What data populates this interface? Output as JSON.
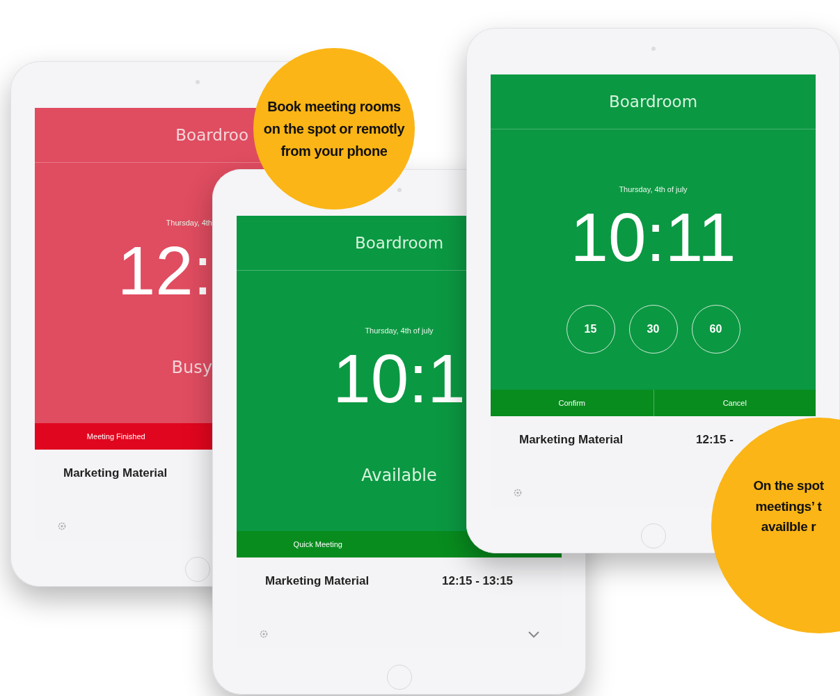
{
  "tablets": [
    {
      "busy": true,
      "room": "Boardroo",
      "date": "Thursday, 4th",
      "time": "12:",
      "state_label": "Busy",
      "actions": [
        "Meeting Finished"
      ],
      "meeting": {
        "title": "Marketing Material"
      }
    },
    {
      "busy": false,
      "room": "Boardroom",
      "date": "Thursday, 4th of july",
      "time": "10:1",
      "state_label": "Available",
      "actions": [
        "Quick Meeting"
      ],
      "meeting": {
        "title": "Marketing Material",
        "time": "12:15 - 13:15"
      },
      "chevron": true
    },
    {
      "busy": false,
      "room": "Boardroom",
      "date": "Thursday, 4th of july",
      "time": "10:11",
      "durations": [
        "15",
        "30",
        "60"
      ],
      "actions": [
        "Confirm",
        "Cancel"
      ],
      "meeting": {
        "title": "Marketing Material",
        "time": "12:15 -"
      }
    }
  ],
  "callouts": [
    {
      "lines": [
        "Book meeting rooms",
        "on the spot or remotly",
        "from your phone"
      ]
    },
    {
      "lines": [
        "On the spot",
        "meetings’ t",
        "availble r"
      ]
    }
  ]
}
